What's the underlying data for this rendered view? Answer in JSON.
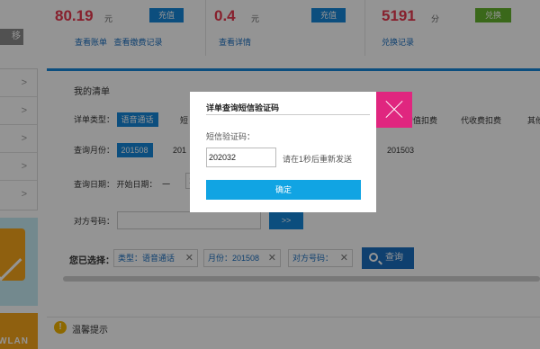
{
  "summary": {
    "move_label": "移",
    "block1": {
      "value": "80.19",
      "unit": "元",
      "button": "充值",
      "links": [
        "查看账单",
        "查看缴费记录"
      ]
    },
    "block2": {
      "value": "0.4",
      "unit": "元",
      "button": "充值",
      "links": [
        "查看详情"
      ]
    },
    "block3": {
      "value": "5191",
      "unit": "分",
      "button": "兑换",
      "links": [
        "兑换记录"
      ]
    }
  },
  "main": {
    "title": "我的清单",
    "type_label": "详单类型：",
    "type_selected": "语音通话",
    "type_partial": "短",
    "type_options": [
      "增值扣费",
      "代收费扣费",
      "其他"
    ],
    "month_label": "查询月份：",
    "month_selected": "201508",
    "month_partial": "201",
    "month_other": "201503",
    "date_label": "查询日期：",
    "start_label": "开始日期：",
    "dash": "一",
    "date_partial": "1",
    "other_label": "对方号码：",
    "go_label": ">>",
    "selected_label": "您已选择：",
    "chips": [
      {
        "key": "类型：",
        "value": "语音通话"
      },
      {
        "key": "月份：",
        "value": "201508"
      },
      {
        "key": "对方号码：",
        "value": ""
      }
    ],
    "query_label": "查询"
  },
  "tip": {
    "text": "温馨提示"
  },
  "promo_text": "WLAN",
  "modal": {
    "title": "详单查询短信验证码",
    "label": "短信验证码：",
    "code_value": "202032",
    "resend_text": "请在1秒后重新发送",
    "confirm": "确定"
  },
  "colors": {
    "accent": "#1687d9",
    "price": "#e8384f",
    "close": "#e0267f",
    "confirm": "#11a4e3"
  }
}
